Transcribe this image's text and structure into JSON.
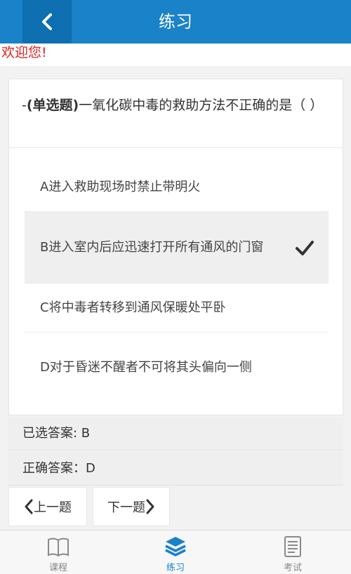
{
  "header": {
    "title": "练习",
    "back_icon": "chevron-left-icon"
  },
  "welcome": "欢迎您!",
  "question": {
    "prefix": "-",
    "type": "(单选题)",
    "text": "一氧化碳中毒的救助方法不正确的是（  ）"
  },
  "options": [
    {
      "label": "A进入救助现场时禁止带明火",
      "selected": false
    },
    {
      "label": "B进入室内后应迅速打开所有通风的门窗",
      "selected": true
    },
    {
      "label": "C将中毒者转移到通风保暖处平卧",
      "selected": false
    },
    {
      "label": "D对于昏迷不醒者不可将其头偏向一侧",
      "selected": false
    }
  ],
  "selected_answer": "已选答案: B",
  "correct_answer": "正确答案：D",
  "nav": {
    "prev": "上一题",
    "next": "下一题"
  },
  "tabs": [
    {
      "label": "课程",
      "icon": "book-icon",
      "active": false
    },
    {
      "label": "练习",
      "icon": "layers-icon",
      "active": true
    },
    {
      "label": "考试",
      "icon": "document-icon",
      "active": false
    }
  ],
  "colors": {
    "brand": "#1a82c8",
    "welcome": "#e02020"
  }
}
